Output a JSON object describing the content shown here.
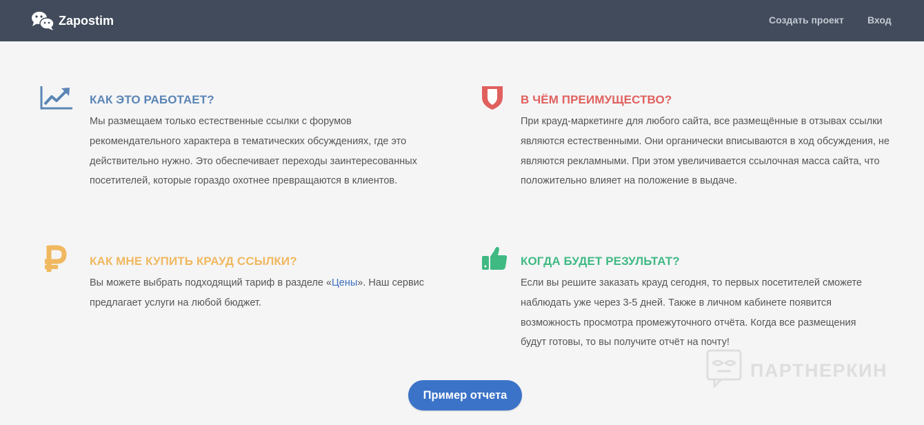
{
  "nav": {
    "brand": "Zapostim",
    "create_project": "Создать проект",
    "login": "Вход"
  },
  "features": [
    {
      "icon": "trend-chart-icon",
      "title": "Как это работает?",
      "text": "Мы размещаем только естественные ссылки с форумов рекомендательного характера в тематических обсуждениях, где это действительно нужно. Это обеспечивает переходы заинтересованных посетителей, которые гораздо охотнее превращаются в клиентов.",
      "color": "#5a85b5"
    },
    {
      "icon": "shield-icon",
      "title": "В чём преимущество?",
      "text": "При крауд-маркетинге для любого сайта, все размещённые в отзывах ссылки являются естественными. Они органически вписываются в ход обсуждения, не являются рекламными. При этом увеличивается ссылочная масса сайта, что положительно влияет на положение в выдаче.",
      "color": "#e0605e"
    },
    {
      "icon": "ruble-icon",
      "title": "Как мне купить крауд ссылки?",
      "text_before": "Вы можете выбрать подходящий тариф в разделе «",
      "link": "Цены",
      "text_after": "». Наш сервис предлагает услуги на любой бюджет.",
      "color": "#f0b85f"
    },
    {
      "icon": "thumbs-up-icon",
      "title": "Когда будет результат?",
      "text": "Если вы решите заказать крауд сегодня, то первых посетителей сможете наблюдать уже через 3-5 дней. Также в личном кабинете появится возможность просмотра промежуточного отчёта. Когда все размещения будут готовы, то вы получите отчёт на почту!",
      "color": "#3fb982"
    }
  ],
  "watermark": "ПАРТНЕРКИН",
  "report_button": "Пример отчета"
}
